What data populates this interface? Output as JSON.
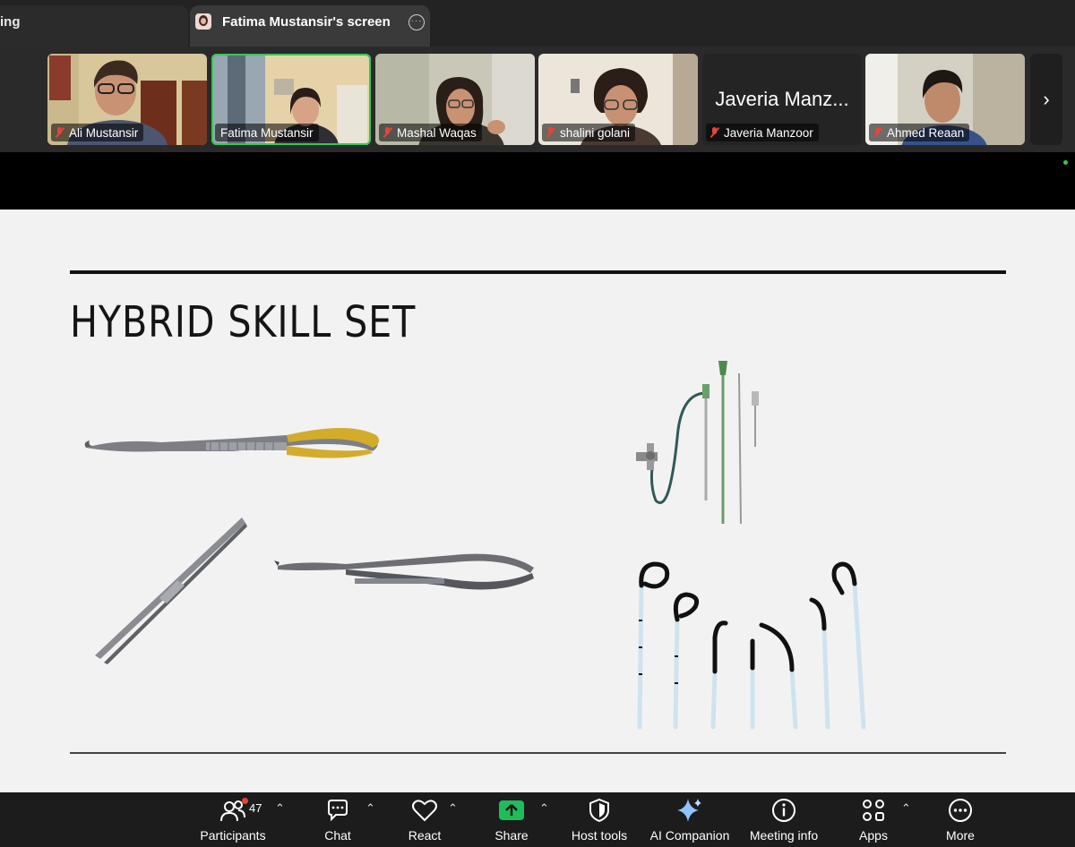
{
  "tabs": {
    "left_partial": "ing",
    "active": "Fatima Mustansir's screen"
  },
  "participants": [
    {
      "name": "Ali Mustansir",
      "muted": true
    },
    {
      "name": "Fatima Mustansir",
      "muted": false
    },
    {
      "name": "Mashal Waqas",
      "muted": true
    },
    {
      "name": "shalini golani",
      "muted": true
    },
    {
      "name": "Javeria Manzoor",
      "display_name": "Javeria Manz...",
      "muted": true
    },
    {
      "name": "Ahmed Reaan",
      "muted": true
    }
  ],
  "slide": {
    "title": "HYBRID SKILL SET"
  },
  "toolbar": {
    "participants_label": "Participants",
    "participants_count": "47",
    "chat_label": "Chat",
    "react_label": "React",
    "share_label": "Share",
    "host_tools_label": "Host tools",
    "ai_companion_label": "AI Companion",
    "meeting_info_label": "Meeting info",
    "apps_label": "Apps",
    "more_label": "More"
  },
  "colors": {
    "active_speaker": "#35c759",
    "muted_mic": "#e5443a",
    "share_green": "#1fbd5a",
    "ai_star": "#8fc4ff"
  },
  "icons": [
    "more-dots-icon",
    "muted-mic-icon",
    "chevron-right-icon",
    "participants-icon",
    "chat-icon",
    "heart-icon",
    "share-up-arrow-icon",
    "shield-icon",
    "sparkle-icon",
    "info-icon",
    "apps-icon",
    "more-circle-icon",
    "caret-up-icon"
  ]
}
